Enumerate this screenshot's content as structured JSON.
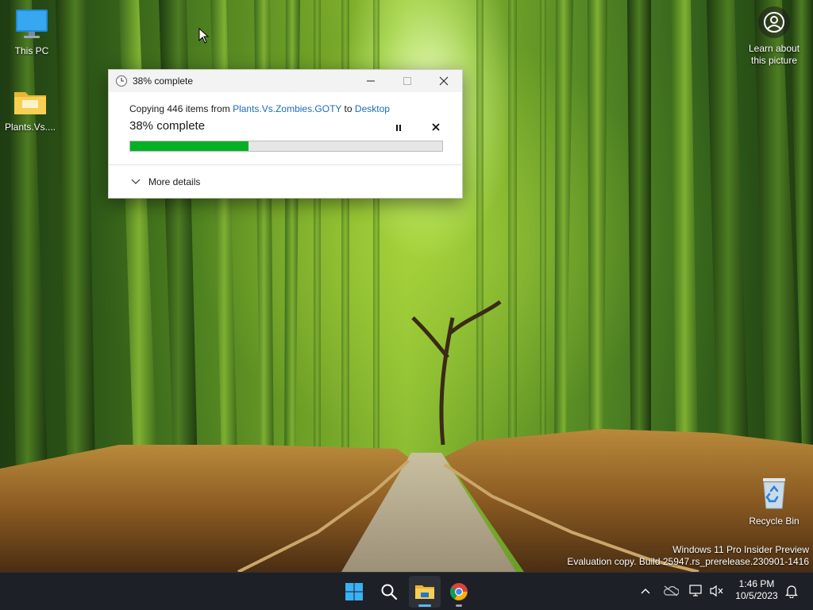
{
  "desktop": {
    "icons": [
      {
        "label": "This PC",
        "icon": "monitor-icon"
      },
      {
        "label": "Plants.Vs....",
        "icon": "folder-icon"
      },
      {
        "label": "Recycle Bin",
        "icon": "recycle-bin-icon"
      }
    ],
    "learn_picture": {
      "line1": "Learn about",
      "line2": "this picture",
      "icon": "camera-icon"
    }
  },
  "copy_dialog": {
    "title": "38% complete",
    "copying_prefix": "Copying 446 items from ",
    "source": "Plants.Vs.Zombies.GOTY",
    "to_word": " to ",
    "destination": "Desktop",
    "percent_text": "38% complete",
    "progress": 0.38,
    "more_details": "More details",
    "controls": {
      "minimize": "minimize-icon",
      "maximize": "maximize-icon",
      "close": "close-icon",
      "pause": "pause-icon",
      "cancel": "cancel-icon"
    },
    "progress_color": "#06b025"
  },
  "watermark": {
    "line1": "Windows 11 Pro Insider Preview",
    "line2": "Evaluation copy. Build 25947.rs_prerelease.230901-1416"
  },
  "taskbar": {
    "apps": [
      {
        "name": "Start",
        "icon": "windows-logo-icon"
      },
      {
        "name": "Search",
        "icon": "search-icon"
      },
      {
        "name": "File Explorer",
        "icon": "file-explorer-icon",
        "active": true
      },
      {
        "name": "Google Chrome",
        "icon": "chrome-icon",
        "running": true
      }
    ],
    "tray": [
      "chevron-up-icon",
      "onedrive-icon",
      "network-icon",
      "volume-muted-icon"
    ],
    "time": "1:46 PM",
    "date": "10/5/2023",
    "notifications_icon": "bell-icon"
  }
}
